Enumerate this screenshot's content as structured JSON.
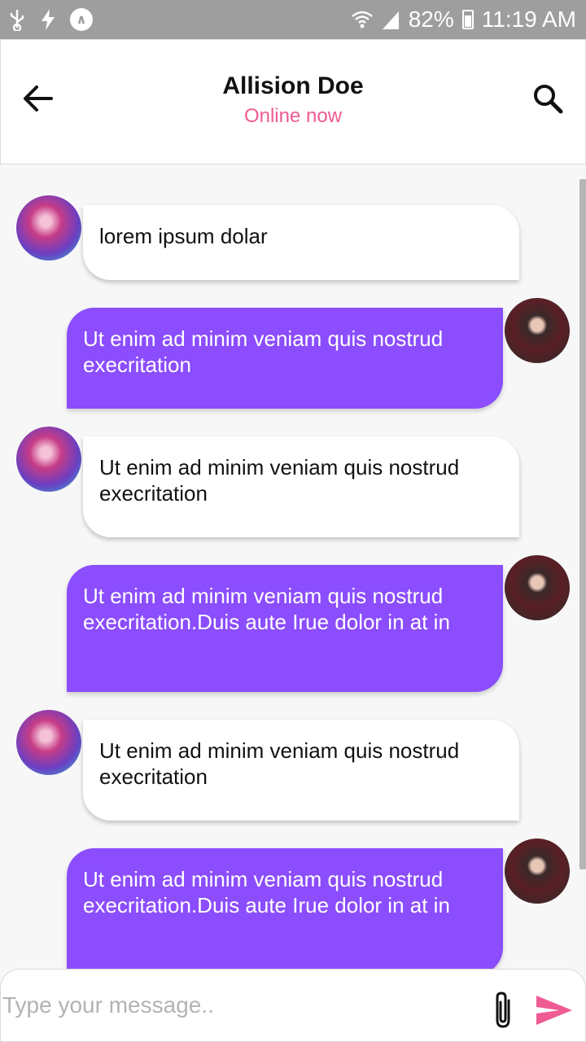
{
  "status_bar": {
    "icons": [
      "usb-icon",
      "charging-icon",
      "app-icon",
      "wifi-icon",
      "signal-icon",
      "battery-icon"
    ],
    "battery": "82%",
    "time": "11:19 AM"
  },
  "header": {
    "title": "Allision Doe",
    "status": "Online now",
    "status_color": "#ef5b93",
    "back_icon": "arrow-left-icon",
    "search_icon": "search-icon"
  },
  "messages": [
    {
      "direction": "incoming",
      "text": "lorem ipsum dolar"
    },
    {
      "direction": "outgoing",
      "text": "Ut enim ad minim veniam quis nostrud execritation"
    },
    {
      "direction": "incoming",
      "text": "Ut enim ad minim veniam quis nostrud execritation"
    },
    {
      "direction": "outgoing",
      "text": "Ut enim ad minim veniam quis nostrud execritation.Duis aute Irue dolor in at in"
    },
    {
      "direction": "incoming",
      "text": "Ut enim ad minim veniam quis nostrud execritation"
    },
    {
      "direction": "outgoing",
      "text": "Ut enim ad minim veniam quis nostrud execritation.Duis aute Irue dolor in at in"
    }
  ],
  "composer": {
    "placeholder": "Type your message..",
    "attach_icon": "paperclip-icon",
    "send_icon": "send-icon"
  },
  "colors": {
    "outgoing_bubble": "#8b4dfd",
    "incoming_bubble": "#ffffff",
    "accent": "#ef5b93"
  }
}
